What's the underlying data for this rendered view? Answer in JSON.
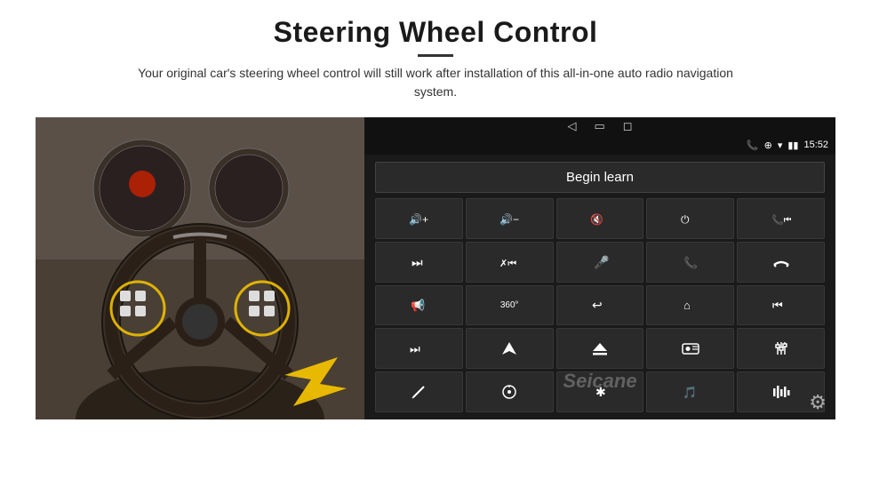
{
  "header": {
    "title": "Steering Wheel Control",
    "subtitle": "Your original car's steering wheel control will still work after installation of this all-in-one auto radio navigation system."
  },
  "screen": {
    "status_bar": {
      "time": "15:52",
      "icons": [
        "phone",
        "location",
        "wifi",
        "signal"
      ]
    },
    "begin_learn_label": "Begin learn",
    "nav_icons": [
      "back",
      "home",
      "square"
    ],
    "grid_icons": [
      {
        "icon": "🔊+",
        "label": "vol-up"
      },
      {
        "icon": "🔊−",
        "label": "vol-down"
      },
      {
        "icon": "🔇",
        "label": "mute"
      },
      {
        "icon": "⏻",
        "label": "power"
      },
      {
        "icon": "📞⏮",
        "label": "phone-prev"
      },
      {
        "icon": "⏭",
        "label": "next"
      },
      {
        "icon": "⏮✗",
        "label": "prev-skip"
      },
      {
        "icon": "🎤",
        "label": "mic"
      },
      {
        "icon": "📞",
        "label": "call"
      },
      {
        "icon": "↩",
        "label": "hang-up"
      },
      {
        "icon": "📢",
        "label": "speaker"
      },
      {
        "icon": "360°",
        "label": "camera360"
      },
      {
        "icon": "↩",
        "label": "back"
      },
      {
        "icon": "🏠",
        "label": "home"
      },
      {
        "icon": "⏮⏮",
        "label": "prev-track"
      },
      {
        "icon": "⏭⏭",
        "label": "fast-fwd"
      },
      {
        "icon": "▶",
        "label": "navigate"
      },
      {
        "icon": "⏏",
        "label": "eject"
      },
      {
        "icon": "📻",
        "label": "radio"
      },
      {
        "icon": "⚙",
        "label": "eq"
      },
      {
        "icon": "✏",
        "label": "pen"
      },
      {
        "icon": "⚙",
        "label": "dial"
      },
      {
        "icon": "✱",
        "label": "bluetooth"
      },
      {
        "icon": "🎵",
        "label": "music"
      },
      {
        "icon": "📊",
        "label": "equalizer"
      }
    ],
    "watermark": "Seicane",
    "settings_icon": "⚙"
  }
}
